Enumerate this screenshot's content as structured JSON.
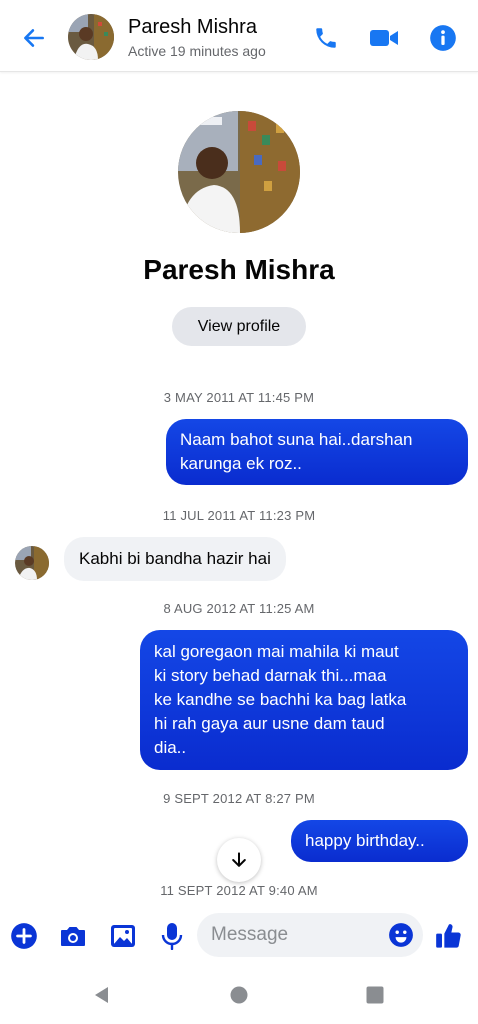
{
  "header": {
    "name": "Paresh Mishra",
    "status": "Active 19 minutes ago",
    "icons": [
      "back-arrow-icon",
      "phone-icon",
      "video-camera-icon",
      "info-icon"
    ]
  },
  "profile": {
    "name": "Paresh Mishra",
    "view_profile_label": "View profile"
  },
  "messages": [
    {
      "timestamp": "3 MAY 2011 AT 11:45 PM",
      "direction": "out",
      "lines": [
        "Naam bahot suna hai..darshan",
        "karunga ek roz.."
      ]
    },
    {
      "timestamp": "11 JUL 2011 AT 11:23 PM",
      "direction": "in",
      "lines": [
        "Kabhi bi bandha hazir hai"
      ]
    },
    {
      "timestamp": "8 AUG 2012 AT 11:25 AM",
      "direction": "out",
      "lines": [
        "kal goregaon mai mahila ki maut",
        "ki story behad darnak thi...maa",
        "ke kandhe se bachhi ka bag latka",
        "hi rah gaya aur usne dam taud",
        "dia.."
      ]
    },
    {
      "timestamp": "9 SEPT 2012 AT 8:27 PM",
      "direction": "out",
      "lines": [
        "happy birthday.."
      ]
    },
    {
      "timestamp": "11 SEPT 2012 AT 9:40 AM"
    }
  ],
  "composer": {
    "placeholder": "Message",
    "icons": [
      "plus-icon",
      "camera-icon",
      "gallery-icon",
      "microphone-icon",
      "emoji-icon",
      "thumbs-up-icon"
    ]
  },
  "colors": {
    "accent": "#1877f2",
    "bubble_out": "#0a35d6",
    "bubble_in": "#f0f2f5"
  }
}
